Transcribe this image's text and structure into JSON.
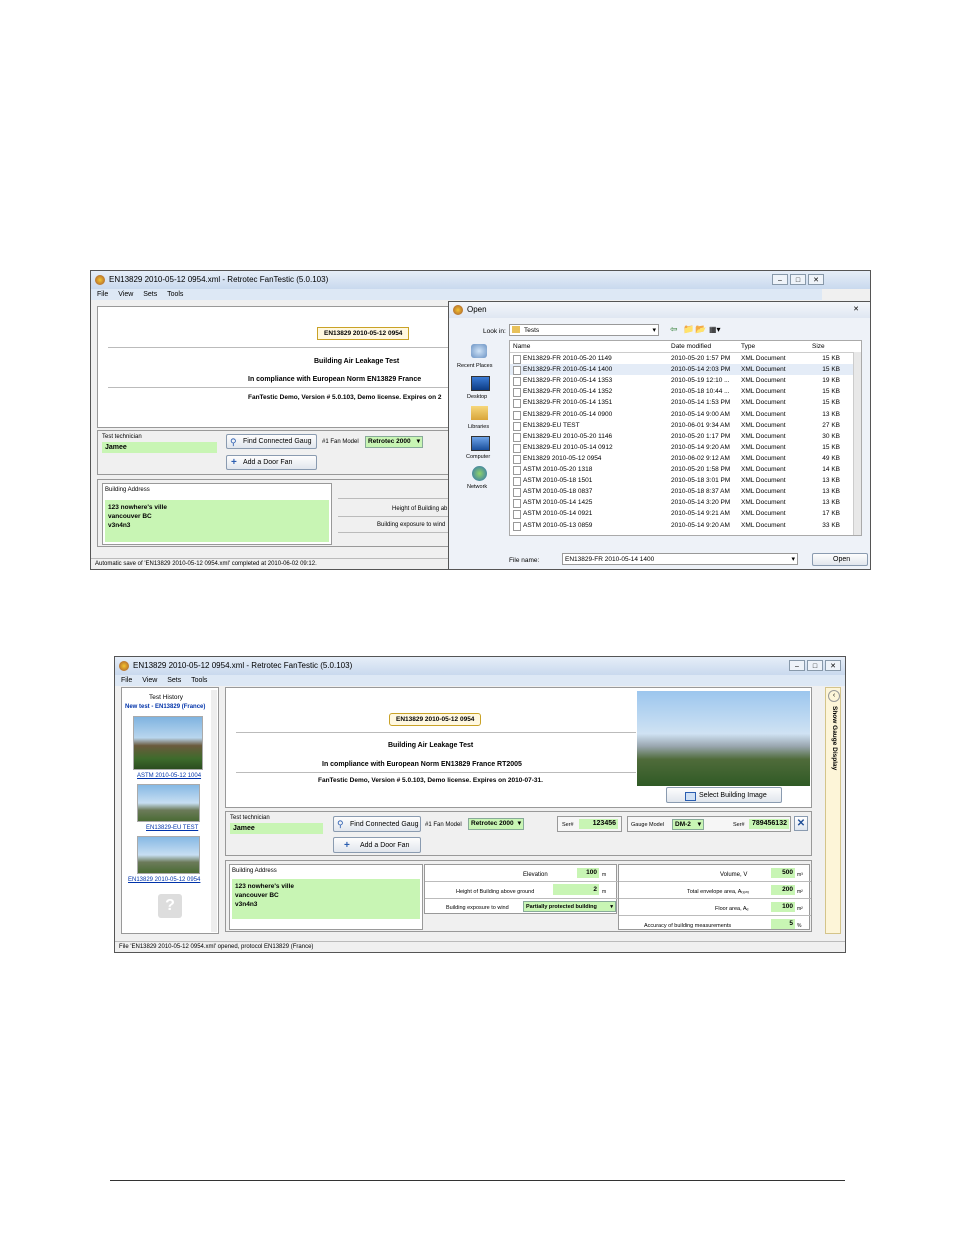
{
  "screen1": {
    "title": "EN13829 2010-05-12 0954.xml - Retrotec FanTestic (5.0.103)",
    "menu": [
      "File",
      "View",
      "Sets",
      "Tools"
    ],
    "test_badge": "EN13829 2010-05-12 0954",
    "heading": "Building Air Leakage Test",
    "compliance": "In compliance with European Norm EN13829 France",
    "version": "FanTestic Demo, Version # 5.0.103, Demo license. Expires on 2",
    "technician_label": "Test technician",
    "technician_value": "Jamee",
    "find_gauges": "Find Connected Gaug",
    "fan_model_label": "#1 Fan Model",
    "fan_model_value": "Retrotec 2000",
    "add_door_fan": "Add a Door Fan",
    "address_label": "Building Address",
    "address_lines": [
      "123 nowhere's ville",
      "vancouver BC",
      "v3n4n3"
    ],
    "height_label": "Height of Building ab",
    "exposure_label": "Building exposure to wind",
    "status": "Automatic save of 'EN13829 2010-05-12 0954.xml' completed at 2010-06-02 09:12.",
    "dialog": {
      "title": "Open",
      "look_in_label": "Look in:",
      "look_in_value": "Tests",
      "places": [
        "Recent Places",
        "Desktop",
        "Libraries",
        "Computer",
        "Network"
      ],
      "columns": [
        "Name",
        "Date modified",
        "Type",
        "Size"
      ],
      "files": [
        {
          "name": "EN13829-FR 2010-05-20 1149",
          "date": "2010-05-20 1:57 PM",
          "type": "XML Document",
          "size": "15 KB"
        },
        {
          "name": "EN13829-FR 2010-05-14 1400",
          "date": "2010-05-14 2:03 PM",
          "type": "XML Document",
          "size": "15 KB"
        },
        {
          "name": "EN13829-FR 2010-05-14 1353",
          "date": "2010-05-19 12:10 ...",
          "type": "XML Document",
          "size": "19 KB"
        },
        {
          "name": "EN13829-FR 2010-05-14 1352",
          "date": "2010-05-18 10:44 ...",
          "type": "XML Document",
          "size": "15 KB"
        },
        {
          "name": "EN13829-FR 2010-05-14 1351",
          "date": "2010-05-14 1:53 PM",
          "type": "XML Document",
          "size": "15 KB"
        },
        {
          "name": "EN13829-FR 2010-05-14 0900",
          "date": "2010-05-14 9:00 AM",
          "type": "XML Document",
          "size": "13 KB"
        },
        {
          "name": "EN13829-EU TEST",
          "date": "2010-06-01 9:34 AM",
          "type": "XML Document",
          "size": "27 KB"
        },
        {
          "name": "EN13829-EU 2010-05-20 1146",
          "date": "2010-05-20 1:17 PM",
          "type": "XML Document",
          "size": "30 KB"
        },
        {
          "name": "EN13829-EU 2010-05-14 0912",
          "date": "2010-05-14 9:20 AM",
          "type": "XML Document",
          "size": "15 KB"
        },
        {
          "name": "EN13829 2010-05-12 0954",
          "date": "2010-06-02 9:12 AM",
          "type": "XML Document",
          "size": "49 KB"
        },
        {
          "name": "ASTM 2010-05-20 1318",
          "date": "2010-05-20 1:58 PM",
          "type": "XML Document",
          "size": "14 KB"
        },
        {
          "name": "ASTM 2010-05-18 1501",
          "date": "2010-05-18 3:01 PM",
          "type": "XML Document",
          "size": "13 KB"
        },
        {
          "name": "ASTM 2010-05-18 0837",
          "date": "2010-05-18 8:37 AM",
          "type": "XML Document",
          "size": "13 KB"
        },
        {
          "name": "ASTM 2010-05-14 1425",
          "date": "2010-05-14 3:20 PM",
          "type": "XML Document",
          "size": "13 KB"
        },
        {
          "name": "ASTM 2010-05-14 0921",
          "date": "2010-05-14 9:21 AM",
          "type": "XML Document",
          "size": "17 KB"
        },
        {
          "name": "ASTM 2010-05-13 0859",
          "date": "2010-05-14 9:20 AM",
          "type": "XML Document",
          "size": "33 KB"
        }
      ],
      "filename_label": "File name:",
      "filename_value": "EN13829-FR 2010-05-14 1400",
      "open_button": "Open"
    }
  },
  "screen2": {
    "title": "EN13829 2010-05-12 0954.xml - Retrotec FanTestic (5.0.103)",
    "menu": [
      "File",
      "View",
      "Sets",
      "Tools"
    ],
    "history_title": "Test History",
    "history_new": "New test - EN13829 (France)",
    "history_items": [
      "ASTM 2010-05-12 1004",
      "EN13829-EU TEST",
      "EN13829 2010-05-12 0954"
    ],
    "test_badge": "EN13829 2010-05-12 0954",
    "heading": "Building Air Leakage Test",
    "compliance": "In compliance with European Norm EN13829 France RT2005",
    "version": "FanTestic Demo, Version # 5.0.103, Demo license. Expires on 2010-07-31.",
    "select_image": "Select Building Image",
    "side_tab": "Show Gauge Display",
    "technician_label": "Test technician",
    "technician_value": "Jamee",
    "find_gauges": "Find Connected Gaug",
    "fan_model_label": "#1 Fan Model",
    "fan_model_value": "Retrotec 2000",
    "ser_label": "Ser#",
    "fan_serial": "123456",
    "gauge_model_label": "Gauge Model",
    "gauge_model_value": "DM-2",
    "gauge_serial": "789456132",
    "add_door_fan": "Add a Door Fan",
    "address_label": "Building Address",
    "address_lines": [
      "123 nowhere's ville",
      "vancouver BC",
      "v3n4n3"
    ],
    "elevation_label": "Elevation",
    "elevation_value": "100",
    "elevation_unit": "m",
    "height_label": "Height of Building above ground",
    "height_value": "2",
    "height_unit": "m",
    "exposure_label": "Building exposure to wind",
    "exposure_value": "Partially protected building",
    "volume_label": "Volume, V",
    "volume_value": "500",
    "volume_unit": "m³",
    "envelope_label": "Total envelope area, Aₜₑₙᵥ",
    "envelope_value": "200",
    "envelope_unit": "m²",
    "floor_label": "Floor area, Aₑ",
    "floor_value": "100",
    "floor_unit": "m²",
    "accuracy_label": "Accuracy of building measurements",
    "accuracy_value": "5",
    "accuracy_unit": "%",
    "status": "File 'EN13829 2010-05-12 0954.xml' opened, protocol EN13829 (France)"
  }
}
